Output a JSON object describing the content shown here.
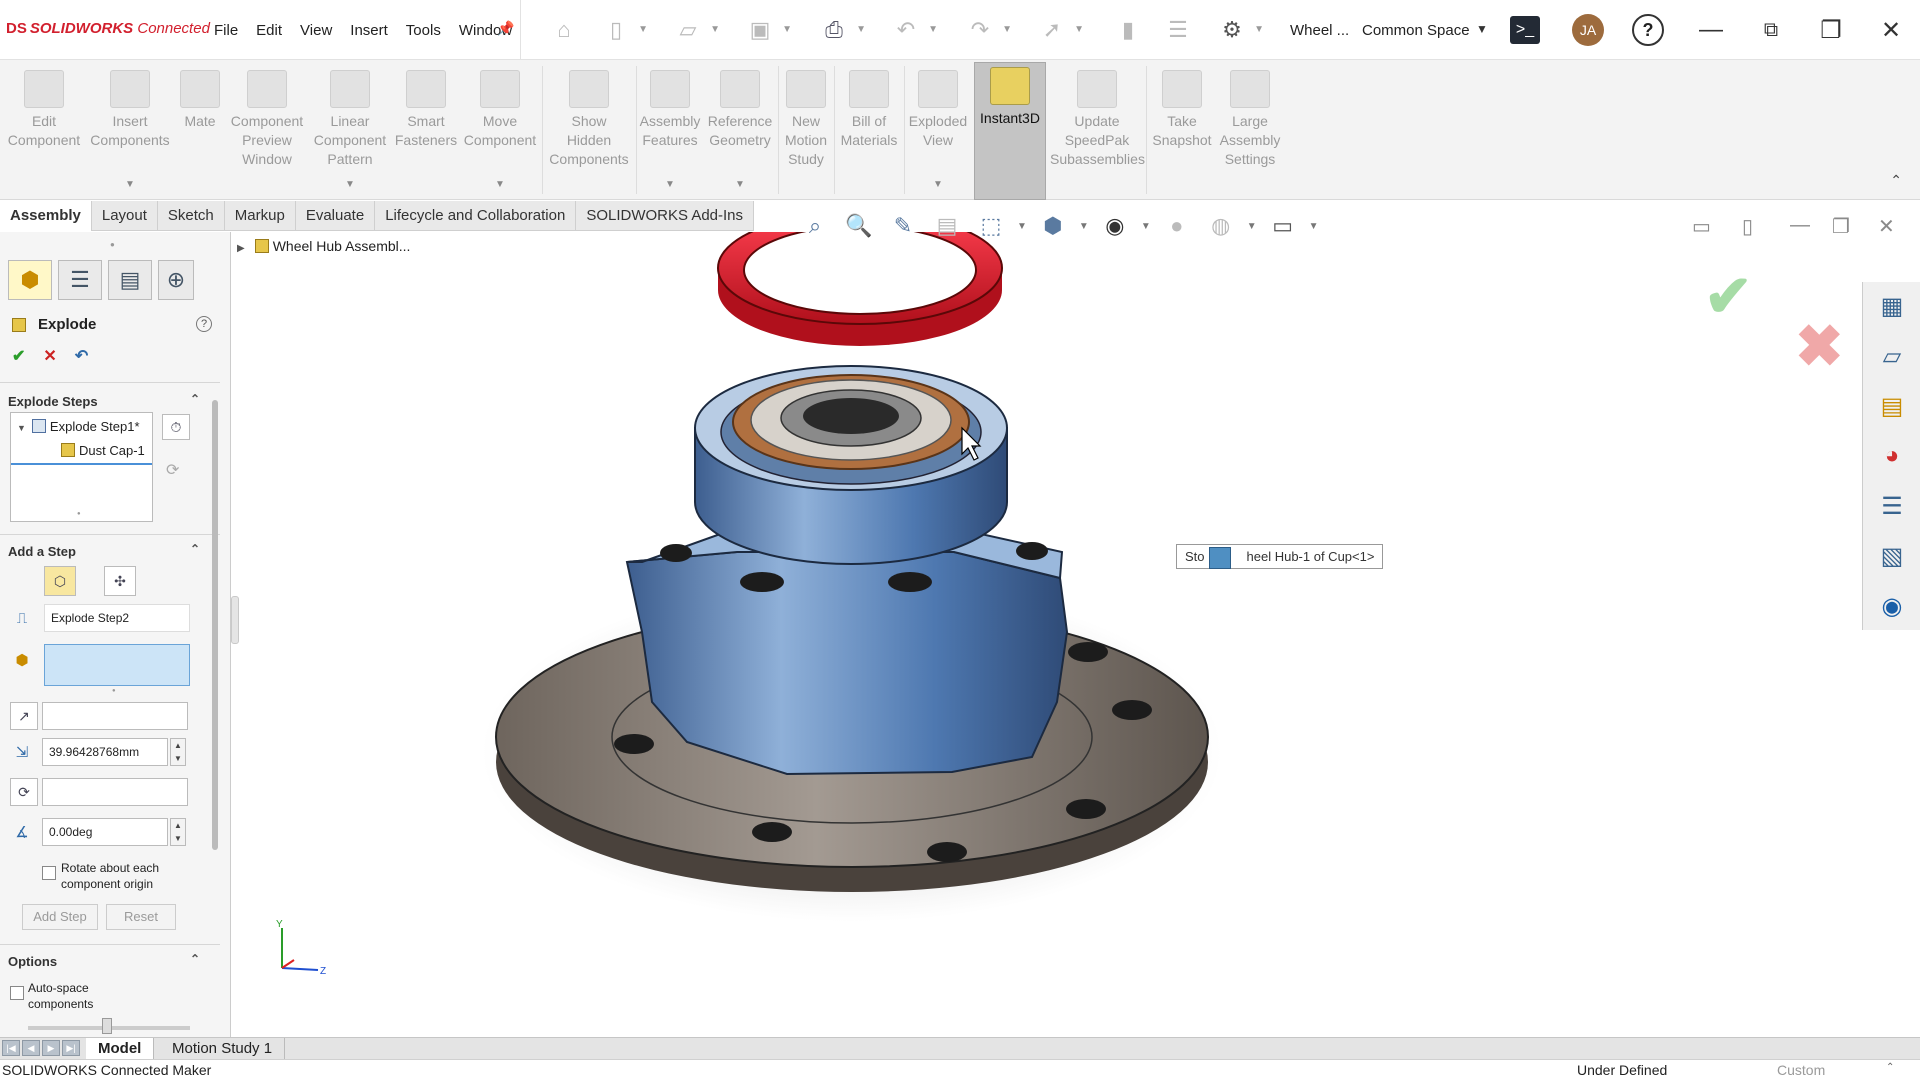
{
  "app": {
    "logo_mark": "DS",
    "logo_brand": "SOLIDWORKS",
    "logo_suffix": "Connected",
    "menu": [
      "File",
      "Edit",
      "View",
      "Insert",
      "Tools",
      "Window"
    ],
    "doc_title": "Wheel ...",
    "space": "Common Space",
    "avatar_initials": "JA",
    "help": "?"
  },
  "ribbon": {
    "buttons": [
      {
        "label": [
          "Edit",
          "Component"
        ],
        "arrow": false
      },
      {
        "label": [
          "Insert",
          "Components"
        ],
        "arrow": true
      },
      {
        "label": [
          "Mate"
        ],
        "arrow": false
      },
      {
        "label": [
          "Component",
          "Preview",
          "Window"
        ],
        "arrow": false
      },
      {
        "label": [
          "Linear",
          "Component",
          "Pattern"
        ],
        "arrow": true
      },
      {
        "label": [
          "Smart",
          "Fasteners"
        ],
        "arrow": false
      },
      {
        "label": [
          "Move",
          "Component"
        ],
        "arrow": true
      },
      {
        "label": [
          "Show",
          "Hidden",
          "Components"
        ],
        "arrow": false
      },
      {
        "label": [
          "Assembly",
          "Features"
        ],
        "arrow": true
      },
      {
        "label": [
          "Reference",
          "Geometry"
        ],
        "arrow": true
      },
      {
        "label": [
          "New",
          "Motion",
          "Study"
        ],
        "arrow": false
      },
      {
        "label": [
          "Bill of",
          "Materials"
        ],
        "arrow": false
      },
      {
        "label": [
          "Exploded",
          "View"
        ],
        "arrow": true
      },
      {
        "label": [
          "Instant3D"
        ],
        "arrow": false
      },
      {
        "label": [
          "Update",
          "SpeedPak",
          "Subassemblies"
        ],
        "arrow": false
      },
      {
        "label": [
          "Take",
          "Snapshot"
        ],
        "arrow": false
      },
      {
        "label": [
          "Large",
          "Assembly",
          "Settings"
        ],
        "arrow": false
      }
    ]
  },
  "tabs": [
    "Assembly",
    "Layout",
    "Sketch",
    "Markup",
    "Evaluate",
    "Lifecycle and Collaboration",
    "SOLIDWORKS Add-Ins"
  ],
  "pm": {
    "title": "Explode",
    "help": "?",
    "sections": {
      "explode_steps": "Explode Steps",
      "add_step": "Add a Step",
      "options": "Options"
    },
    "tree": {
      "step": "Explode Step1*",
      "component": "Dust Cap-1"
    },
    "step_name": "Explode Step2",
    "components_value": "",
    "direction_value": "",
    "distance": "39.96428768mm",
    "rotation_axis_value": "",
    "angle": "0.00deg",
    "rotate_checkbox_label": [
      "Rotate about each",
      "component origin"
    ],
    "add_step_button": "Add Step",
    "reset_button": "Reset",
    "auto_space_label": [
      "Auto-space",
      "components"
    ]
  },
  "viewport": {
    "breadcrumb": "Wheel Hub Assembl...",
    "tooltip": "Sto",
    "tooltip_rest": "heel Hub-1 of Cup<1>",
    "triad": {
      "y": "Y",
      "z": "Z"
    }
  },
  "bottom_tabs": [
    "Model",
    "Motion Study 1"
  ],
  "status": {
    "left": "SOLIDWORKS Connected Maker",
    "mid": "Under Defined",
    "right": "Custom"
  },
  "colors": {
    "red_ring": "#e01a2a",
    "blue_part": "#4f7fbd",
    "bronze": "#b07040",
    "flange": "#8a7e74"
  }
}
